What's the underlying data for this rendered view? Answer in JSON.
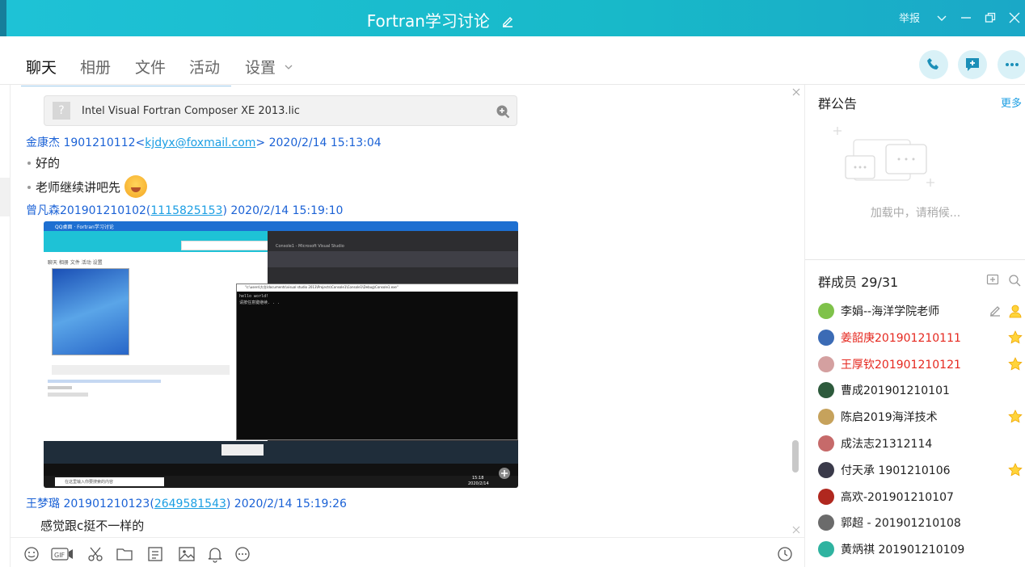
{
  "window": {
    "title": "Fortran学习讨论",
    "report_label": "举报"
  },
  "tabs": [
    {
      "label": "聊天",
      "active": true
    },
    {
      "label": "相册"
    },
    {
      "label": "文件"
    },
    {
      "label": "活动"
    },
    {
      "label": "设置"
    }
  ],
  "chat": {
    "file_card": {
      "name": "Intel Visual Fortran Composer XE 2013.lic"
    },
    "messages": [
      {
        "sender": "金康杰 1901210112<",
        "link": "kjdyx@foxmail.com",
        "tail": "> 2020/2/14 15:13:04",
        "lines": [
          "好的",
          "老师继续讲吧先"
        ]
      },
      {
        "sender": "曾凡森201901210102(",
        "link": "1115825153",
        "tail": ") 2020/2/14 15:19:10"
      },
      {
        "sender": "王梦璐 201901210123(",
        "link": "2649581543",
        "tail": ") 2020/2/14 15:19:26",
        "lines": [
          "感觉跟c挺不一样的"
        ]
      }
    ],
    "screenshot": {
      "win_title": "QQ桌面 · Fortran学习讨论",
      "tabs_small": "聊天  相册  文件  活动  设置",
      "vs_title": "Console1 - Microsoft Visual Studio",
      "cmd_title": "\"c:\\users\\大仓\\documents\\visual studio 2013\\Projects\\Console1\\Console1\\Debug\\Console1.exe\"",
      "cmd_line1": "hello world!",
      "cmd_line2": "请按任意键继续. . .",
      "search_placeholder": "在这里输入你要搜索的内容",
      "clock": "15:18",
      "date": "2020/2/14"
    }
  },
  "right": {
    "notice_title": "群公告",
    "more_label": "更多",
    "loading_text": "加载中，请稍候...",
    "members_title": "群成员 29/31",
    "members": [
      {
        "name": "李娟--海洋学院老师",
        "color": "#222",
        "av": "#7fc24a",
        "role": "owner"
      },
      {
        "name": "姜韶庚201901210111",
        "color": "#e5281f",
        "av": "#3b6bb5",
        "role": "admin"
      },
      {
        "name": "王厚钦201901210121",
        "color": "#e5281f",
        "av": "#d4a0a0",
        "role": "admin"
      },
      {
        "name": "曹成201901210101",
        "color": "#222",
        "av": "#2d5a3c",
        "role": ""
      },
      {
        "name": "陈启2019海洋技术",
        "color": "#222",
        "av": "#c6a25c",
        "role": "admin"
      },
      {
        "name": "成法志21312114",
        "color": "#222",
        "av": "#c66a6a",
        "role": ""
      },
      {
        "name": "付天承 1901210106",
        "color": "#222",
        "av": "#3a3a4a",
        "role": "admin"
      },
      {
        "name": "高欢-201901210107",
        "color": "#222",
        "av": "#b0281f",
        "role": ""
      },
      {
        "name": "郭超 - 201901210108",
        "color": "#222",
        "av": "#6b6b6b",
        "role": ""
      },
      {
        "name": "黄炳祺 201901210109",
        "color": "#222",
        "av": "#2fb3a0",
        "role": ""
      }
    ]
  }
}
